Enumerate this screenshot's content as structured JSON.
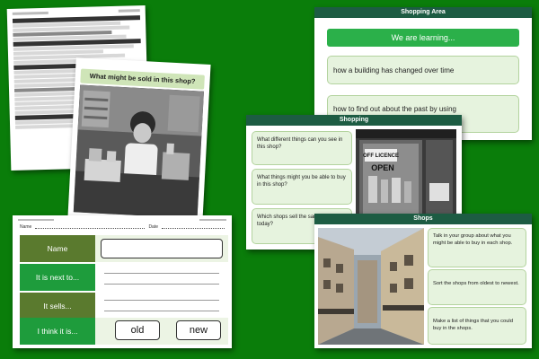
{
  "photo_slide": {
    "title": "What might be sold in this shop?"
  },
  "worksheet": {
    "name_label": "Name",
    "date_label": "Date",
    "rows": [
      {
        "label": "Name"
      },
      {
        "label": "It is next to..."
      },
      {
        "label": "It sells..."
      },
      {
        "label": "I think it is..."
      }
    ],
    "choice_old": "old",
    "choice_new": "new"
  },
  "area_slide": {
    "title": "Shopping Area",
    "learning_heading": "We are learning...",
    "objectives": [
      "how a building has changed over time",
      "how to find out about the past by using"
    ]
  },
  "shop_slide": {
    "title": "Shopping",
    "questions": [
      "What different things can you see in this shop?",
      "What things might you be able to buy in this shop?",
      "Which shops sell the same things today?"
    ],
    "sign_text": [
      "OFF LICENCE",
      "OPEN"
    ]
  },
  "shops_slide": {
    "title": "Shops",
    "tasks": [
      "Talk in your group about what you might be able to buy in each shop.",
      "Sort the shops from oldest to newest.",
      "Make a list of things that you could buy in the shops."
    ]
  },
  "colors": {
    "background": "#0a7d0a",
    "title_bar": "#1d5c43",
    "learning_bar": "#2bb04a",
    "box_fill": "#e6f3de",
    "ws_dark_green": "#5a7a2e",
    "ws_bright_green": "#1e9c3c"
  }
}
